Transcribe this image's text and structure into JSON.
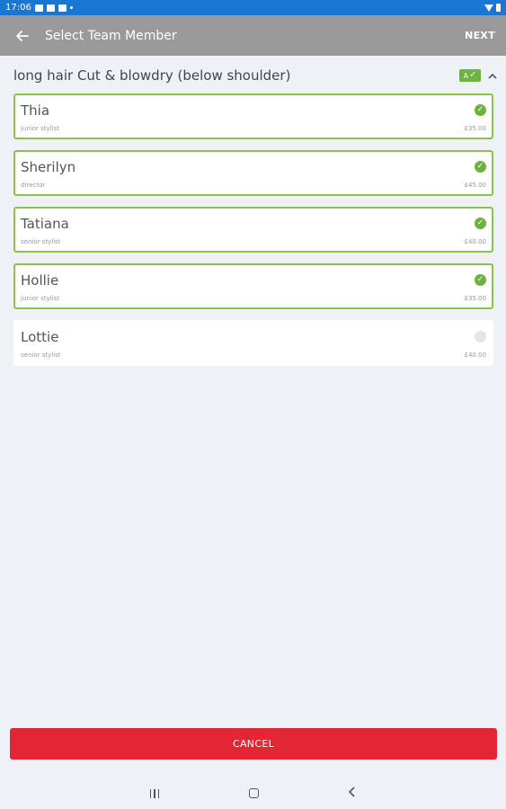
{
  "status_bar": {
    "time": "17:06"
  },
  "app_bar": {
    "back_icon": "arrow-left-icon",
    "title": "Select Team Member",
    "next_label": "NEXT"
  },
  "service": {
    "title": "long hair Cut & blowdry (below shoulder)",
    "all_toggle_label": "A",
    "all_toggle_tick": "✓",
    "collapse_icon": "chevron-up-icon"
  },
  "members": [
    {
      "name": "Thia",
      "role": "junior stylist",
      "price": "£35.00",
      "selected": true
    },
    {
      "name": "Sherilyn",
      "role": "director",
      "price": "£45.00",
      "selected": true
    },
    {
      "name": "Tatiana",
      "role": "senior stylist",
      "price": "£40.00",
      "selected": true
    },
    {
      "name": "Hollie",
      "role": "junior stylist",
      "price": "£35.00",
      "selected": true
    },
    {
      "name": "Lottie",
      "role": "senior stylist",
      "price": "£40.00",
      "selected": false
    }
  ],
  "cancel_label": "CANCEL",
  "colors": {
    "status_bar": "#1976d2",
    "app_bar": "#9a9a9a",
    "selected_border": "#8bc34a",
    "check": "#6db33f",
    "cancel": "#e32636",
    "background": "#eef2f7"
  }
}
